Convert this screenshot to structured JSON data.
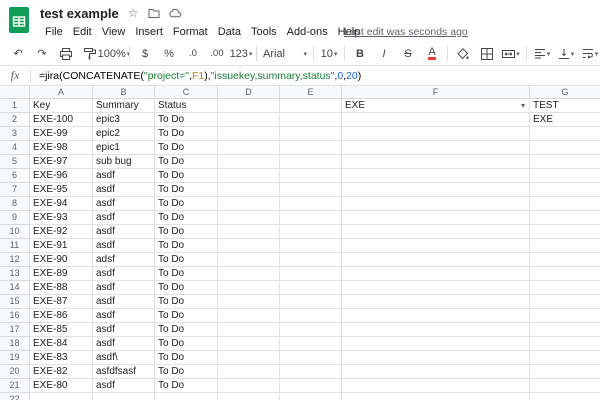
{
  "colors": {
    "logo_green": "#0f9d58",
    "text_color_indicator": "#ea4335",
    "formula_string": "#188038",
    "formula_ref": "#e8710a",
    "formula_number": "#1967d2"
  },
  "app": {
    "title": "test example"
  },
  "header": {
    "menus": [
      {
        "label": "File"
      },
      {
        "label": "Edit"
      },
      {
        "label": "View"
      },
      {
        "label": "Insert"
      },
      {
        "label": "Format"
      },
      {
        "label": "Data"
      },
      {
        "label": "Tools"
      },
      {
        "label": "Add-ons"
      },
      {
        "label": "Help"
      }
    ],
    "last_edit": "Last edit was seconds ago"
  },
  "toolbar": {
    "undo": "↶",
    "redo": "↷",
    "zoom": "100%",
    "currency": "$",
    "percent": "%",
    "decrease_decimal": ".0",
    "increase_decimal": ".00",
    "more_formats": "123",
    "font": "Arial",
    "font_size": "10",
    "bold": "B",
    "italic": "I",
    "strikethrough": "S",
    "text_color": "A"
  },
  "formula_bar": {
    "fx_label": "fx",
    "segments": [
      {
        "text": "=jira(CONCATENATE(",
        "color": "#000000"
      },
      {
        "text": "\"project=\"",
        "color": "#188038"
      },
      {
        "text": ",",
        "color": "#000000"
      },
      {
        "text": "F1",
        "color": "#e8710a"
      },
      {
        "text": "),",
        "color": "#000000"
      },
      {
        "text": "\"issuekey,summary,status\"",
        "color": "#188038"
      },
      {
        "text": ",",
        "color": "#000000"
      },
      {
        "text": "0",
        "color": "#1967d2"
      },
      {
        "text": ",",
        "color": "#000000"
      },
      {
        "text": "20",
        "color": "#1967d2"
      },
      {
        "text": ")",
        "color": "#000000"
      }
    ]
  },
  "grid": {
    "col_letters": [
      "A",
      "B",
      "C",
      "D",
      "E",
      "F",
      "G"
    ],
    "row1": {
      "num": "1",
      "key": "Key",
      "summary": "Summary",
      "status": "Status",
      "f": "EXE",
      "g": "TEST"
    },
    "rows": [
      {
        "num": "2",
        "key": "EXE-100",
        "summary": "epic3",
        "status": "To Do",
        "g": "EXE"
      },
      {
        "num": "3",
        "key": "EXE-99",
        "summary": "epic2",
        "status": "To Do",
        "g": ""
      },
      {
        "num": "4",
        "key": "EXE-98",
        "summary": "epic1",
        "status": "To Do",
        "g": ""
      },
      {
        "num": "5",
        "key": "EXE-97",
        "summary": "sub bug",
        "status": "To Do",
        "g": ""
      },
      {
        "num": "6",
        "key": "EXE-96",
        "summary": "asdf",
        "status": "To Do",
        "g": ""
      },
      {
        "num": "7",
        "key": "EXE-95",
        "summary": "asdf",
        "status": "To Do",
        "g": ""
      },
      {
        "num": "8",
        "key": "EXE-94",
        "summary": "asdf",
        "status": "To Do",
        "g": ""
      },
      {
        "num": "9",
        "key": "EXE-93",
        "summary": "asdf",
        "status": "To Do",
        "g": ""
      },
      {
        "num": "10",
        "key": "EXE-92",
        "summary": "asdf",
        "status": "To Do",
        "g": ""
      },
      {
        "num": "11",
        "key": "EXE-91",
        "summary": "asdf",
        "status": "To Do",
        "g": ""
      },
      {
        "num": "12",
        "key": "EXE-90",
        "summary": "adsf",
        "status": "To Do",
        "g": ""
      },
      {
        "num": "13",
        "key": "EXE-89",
        "summary": "asdf",
        "status": "To Do",
        "g": ""
      },
      {
        "num": "14",
        "key": "EXE-88",
        "summary": "asdf",
        "status": "To Do",
        "g": ""
      },
      {
        "num": "15",
        "key": "EXE-87",
        "summary": "asdf",
        "status": "To Do",
        "g": ""
      },
      {
        "num": "16",
        "key": "EXE-86",
        "summary": "asdf",
        "status": "To Do",
        "g": ""
      },
      {
        "num": "17",
        "key": "EXE-85",
        "summary": "asdf",
        "status": "To Do",
        "g": ""
      },
      {
        "num": "18",
        "key": "EXE-84",
        "summary": "asdf",
        "status": "To Do",
        "g": ""
      },
      {
        "num": "19",
        "key": "EXE-83",
        "summary": "asdf\\",
        "status": "To Do",
        "g": ""
      },
      {
        "num": "20",
        "key": "EXE-82",
        "summary": "asfdfsasf",
        "status": "To Do",
        "g": ""
      },
      {
        "num": "21",
        "key": "EXE-80",
        "summary": "asdf",
        "status": "To Do",
        "g": ""
      },
      {
        "num": "22",
        "key": "",
        "summary": "",
        "status": "",
        "g": ""
      }
    ]
  }
}
